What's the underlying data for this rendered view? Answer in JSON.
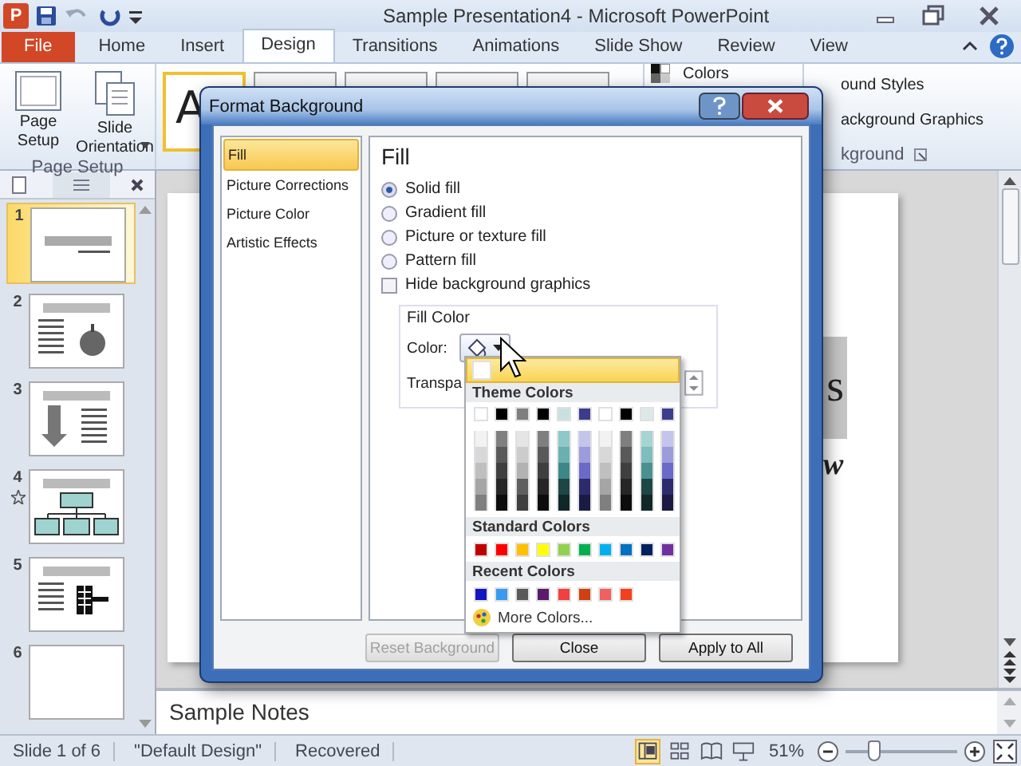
{
  "window": {
    "app_letter": "P",
    "title": "Sample Presentation4 - Microsoft PowerPoint"
  },
  "ribbon_tabs": [
    {
      "label": "File",
      "kind": "file",
      "selected": false
    },
    {
      "label": "Home",
      "kind": "tab",
      "selected": false
    },
    {
      "label": "Insert",
      "kind": "tab",
      "selected": false
    },
    {
      "label": "Design",
      "kind": "tab",
      "selected": true
    },
    {
      "label": "Transitions",
      "kind": "tab",
      "selected": false
    },
    {
      "label": "Animations",
      "kind": "tab",
      "selected": false
    },
    {
      "label": "Slide Show",
      "kind": "tab",
      "selected": false
    },
    {
      "label": "Review",
      "kind": "tab",
      "selected": false
    },
    {
      "label": "View",
      "kind": "tab",
      "selected": false
    }
  ],
  "ribbon": {
    "page_setup_buttons": [
      {
        "label": "Page Setup",
        "kind": "page"
      },
      {
        "label": "Slide Orientation",
        "kind": "orientation"
      }
    ],
    "page_setup_group": "Page Setup",
    "theme_preview": "A",
    "colors_button": "Colors",
    "background_styles": "ound Styles",
    "hide_background_graphics": "ackground Graphics",
    "background_group": "kground"
  },
  "slides": [
    {
      "number": "1",
      "kind": "title",
      "selected": true,
      "animated": false
    },
    {
      "number": "2",
      "kind": "apple",
      "selected": false,
      "animated": false
    },
    {
      "number": "3",
      "kind": "arrow",
      "selected": false,
      "animated": false
    },
    {
      "number": "4",
      "kind": "org",
      "selected": false,
      "animated": true
    },
    {
      "number": "5",
      "kind": "table",
      "selected": false,
      "animated": false
    },
    {
      "number": "6",
      "kind": "blank",
      "selected": false,
      "animated": false
    }
  ],
  "slide": {
    "title_fragment": "s",
    "subtitle_fragment": "w"
  },
  "notes": "Sample Notes",
  "status_bar": {
    "slide_info": "Slide 1 of 6",
    "theme": "\"Default Design\"",
    "state": "Recovered",
    "views": [
      {
        "kind": "normal",
        "selected": true
      },
      {
        "kind": "sorter",
        "selected": false
      },
      {
        "kind": "reading",
        "selected": false
      },
      {
        "kind": "show",
        "selected": false
      }
    ],
    "zoom": "51%",
    "zoom_slider": {
      "level": 0.25
    }
  },
  "dialog": {
    "title": "Format Background",
    "nav": [
      {
        "label": "Fill",
        "selected": true
      },
      {
        "label": "Picture Corrections",
        "selected": false
      },
      {
        "label": "Picture Color",
        "selected": false
      },
      {
        "label": "Artistic Effects",
        "selected": false
      }
    ],
    "heading": "Fill",
    "fill_options": [
      {
        "label": "Solid fill",
        "selected": true
      },
      {
        "label": "Gradient fill",
        "selected": false
      },
      {
        "label": "Picture or texture fill",
        "selected": false
      },
      {
        "label": "Pattern fill",
        "selected": false
      }
    ],
    "hide_graphics": {
      "label": "Hide background graphics",
      "checked": false
    },
    "fill_color": {
      "legend": "Fill Color",
      "color_label": "Color:",
      "transparency_label": "Transpa"
    },
    "buttons": [
      {
        "label": "Reset Background",
        "disabled": true
      },
      {
        "label": "Close",
        "disabled": false
      },
      {
        "label": "Apply to All",
        "disabled": false
      }
    ]
  },
  "palette": {
    "automatic": {
      "color": "#ffffff"
    },
    "theme_heading": "Theme Colors",
    "theme_top": [
      {
        "color": "#ffffff"
      },
      {
        "color": "#000000"
      },
      {
        "color": "#7f7f7f"
      },
      {
        "color": "#000000"
      },
      {
        "color": "#c8e0e0"
      },
      {
        "color": "#3c3c8c"
      },
      {
        "color": "#ffffff"
      },
      {
        "color": "#000000"
      },
      {
        "color": "#dde8e8"
      },
      {
        "color": "#3c3c8c"
      }
    ],
    "theme_shades": [
      [
        {
          "color": "#f2f2f2"
        },
        {
          "color": "#d8d8d8"
        },
        {
          "color": "#bfbfbf"
        },
        {
          "color": "#a5a5a5"
        },
        {
          "color": "#7f7f7f"
        }
      ],
      [
        {
          "color": "#7f7f7f"
        },
        {
          "color": "#595959"
        },
        {
          "color": "#3f3f3f"
        },
        {
          "color": "#262626"
        },
        {
          "color": "#0c0c0c"
        }
      ],
      [
        {
          "color": "#e5e5e5"
        },
        {
          "color": "#cccccc"
        },
        {
          "color": "#b2b2b2"
        },
        {
          "color": "#5f5f5f"
        },
        {
          "color": "#3f3f3f"
        }
      ],
      [
        {
          "color": "#7f7f7f"
        },
        {
          "color": "#595959"
        },
        {
          "color": "#3f3f3f"
        },
        {
          "color": "#262626"
        },
        {
          "color": "#0c0c0c"
        }
      ],
      [
        {
          "color": "#8ec8c8"
        },
        {
          "color": "#6ab0b0"
        },
        {
          "color": "#3c8888"
        },
        {
          "color": "#1e4646"
        },
        {
          "color": "#102828"
        }
      ],
      [
        {
          "color": "#c4c4ec"
        },
        {
          "color": "#9c9cdc"
        },
        {
          "color": "#6a6ac8"
        },
        {
          "color": "#2c2c6c"
        },
        {
          "color": "#1a1a44"
        }
      ],
      [
        {
          "color": "#f2f2f2"
        },
        {
          "color": "#d8d8d8"
        },
        {
          "color": "#bfbfbf"
        },
        {
          "color": "#a5a5a5"
        },
        {
          "color": "#7f7f7f"
        }
      ],
      [
        {
          "color": "#7f7f7f"
        },
        {
          "color": "#595959"
        },
        {
          "color": "#3f3f3f"
        },
        {
          "color": "#262626"
        },
        {
          "color": "#0c0c0c"
        }
      ],
      [
        {
          "color": "#a6d4d4"
        },
        {
          "color": "#80bcbc"
        },
        {
          "color": "#4a9090"
        },
        {
          "color": "#1e4646"
        },
        {
          "color": "#102828"
        }
      ],
      [
        {
          "color": "#c4c4ec"
        },
        {
          "color": "#9c9cdc"
        },
        {
          "color": "#6a6ac8"
        },
        {
          "color": "#2c2c6c"
        },
        {
          "color": "#1a1a44"
        }
      ]
    ],
    "standard_heading": "Standard Colors",
    "standard": [
      {
        "color": "#c00000"
      },
      {
        "color": "#ff0000"
      },
      {
        "color": "#ffc000"
      },
      {
        "color": "#ffff00"
      },
      {
        "color": "#92d050"
      },
      {
        "color": "#00b050"
      },
      {
        "color": "#00b0f0"
      },
      {
        "color": "#0070c0"
      },
      {
        "color": "#002060"
      },
      {
        "color": "#7030a0"
      }
    ],
    "recent_heading": "Recent Colors",
    "recent": [
      {
        "color": "#1414c0"
      },
      {
        "color": "#3a9af0"
      },
      {
        "color": "#595959"
      },
      {
        "color": "#5a1a6a"
      },
      {
        "color": "#f04040"
      },
      {
        "color": "#d04010"
      },
      {
        "color": "#f06060"
      },
      {
        "color": "#f04020"
      }
    ],
    "more": "More Colors..."
  }
}
